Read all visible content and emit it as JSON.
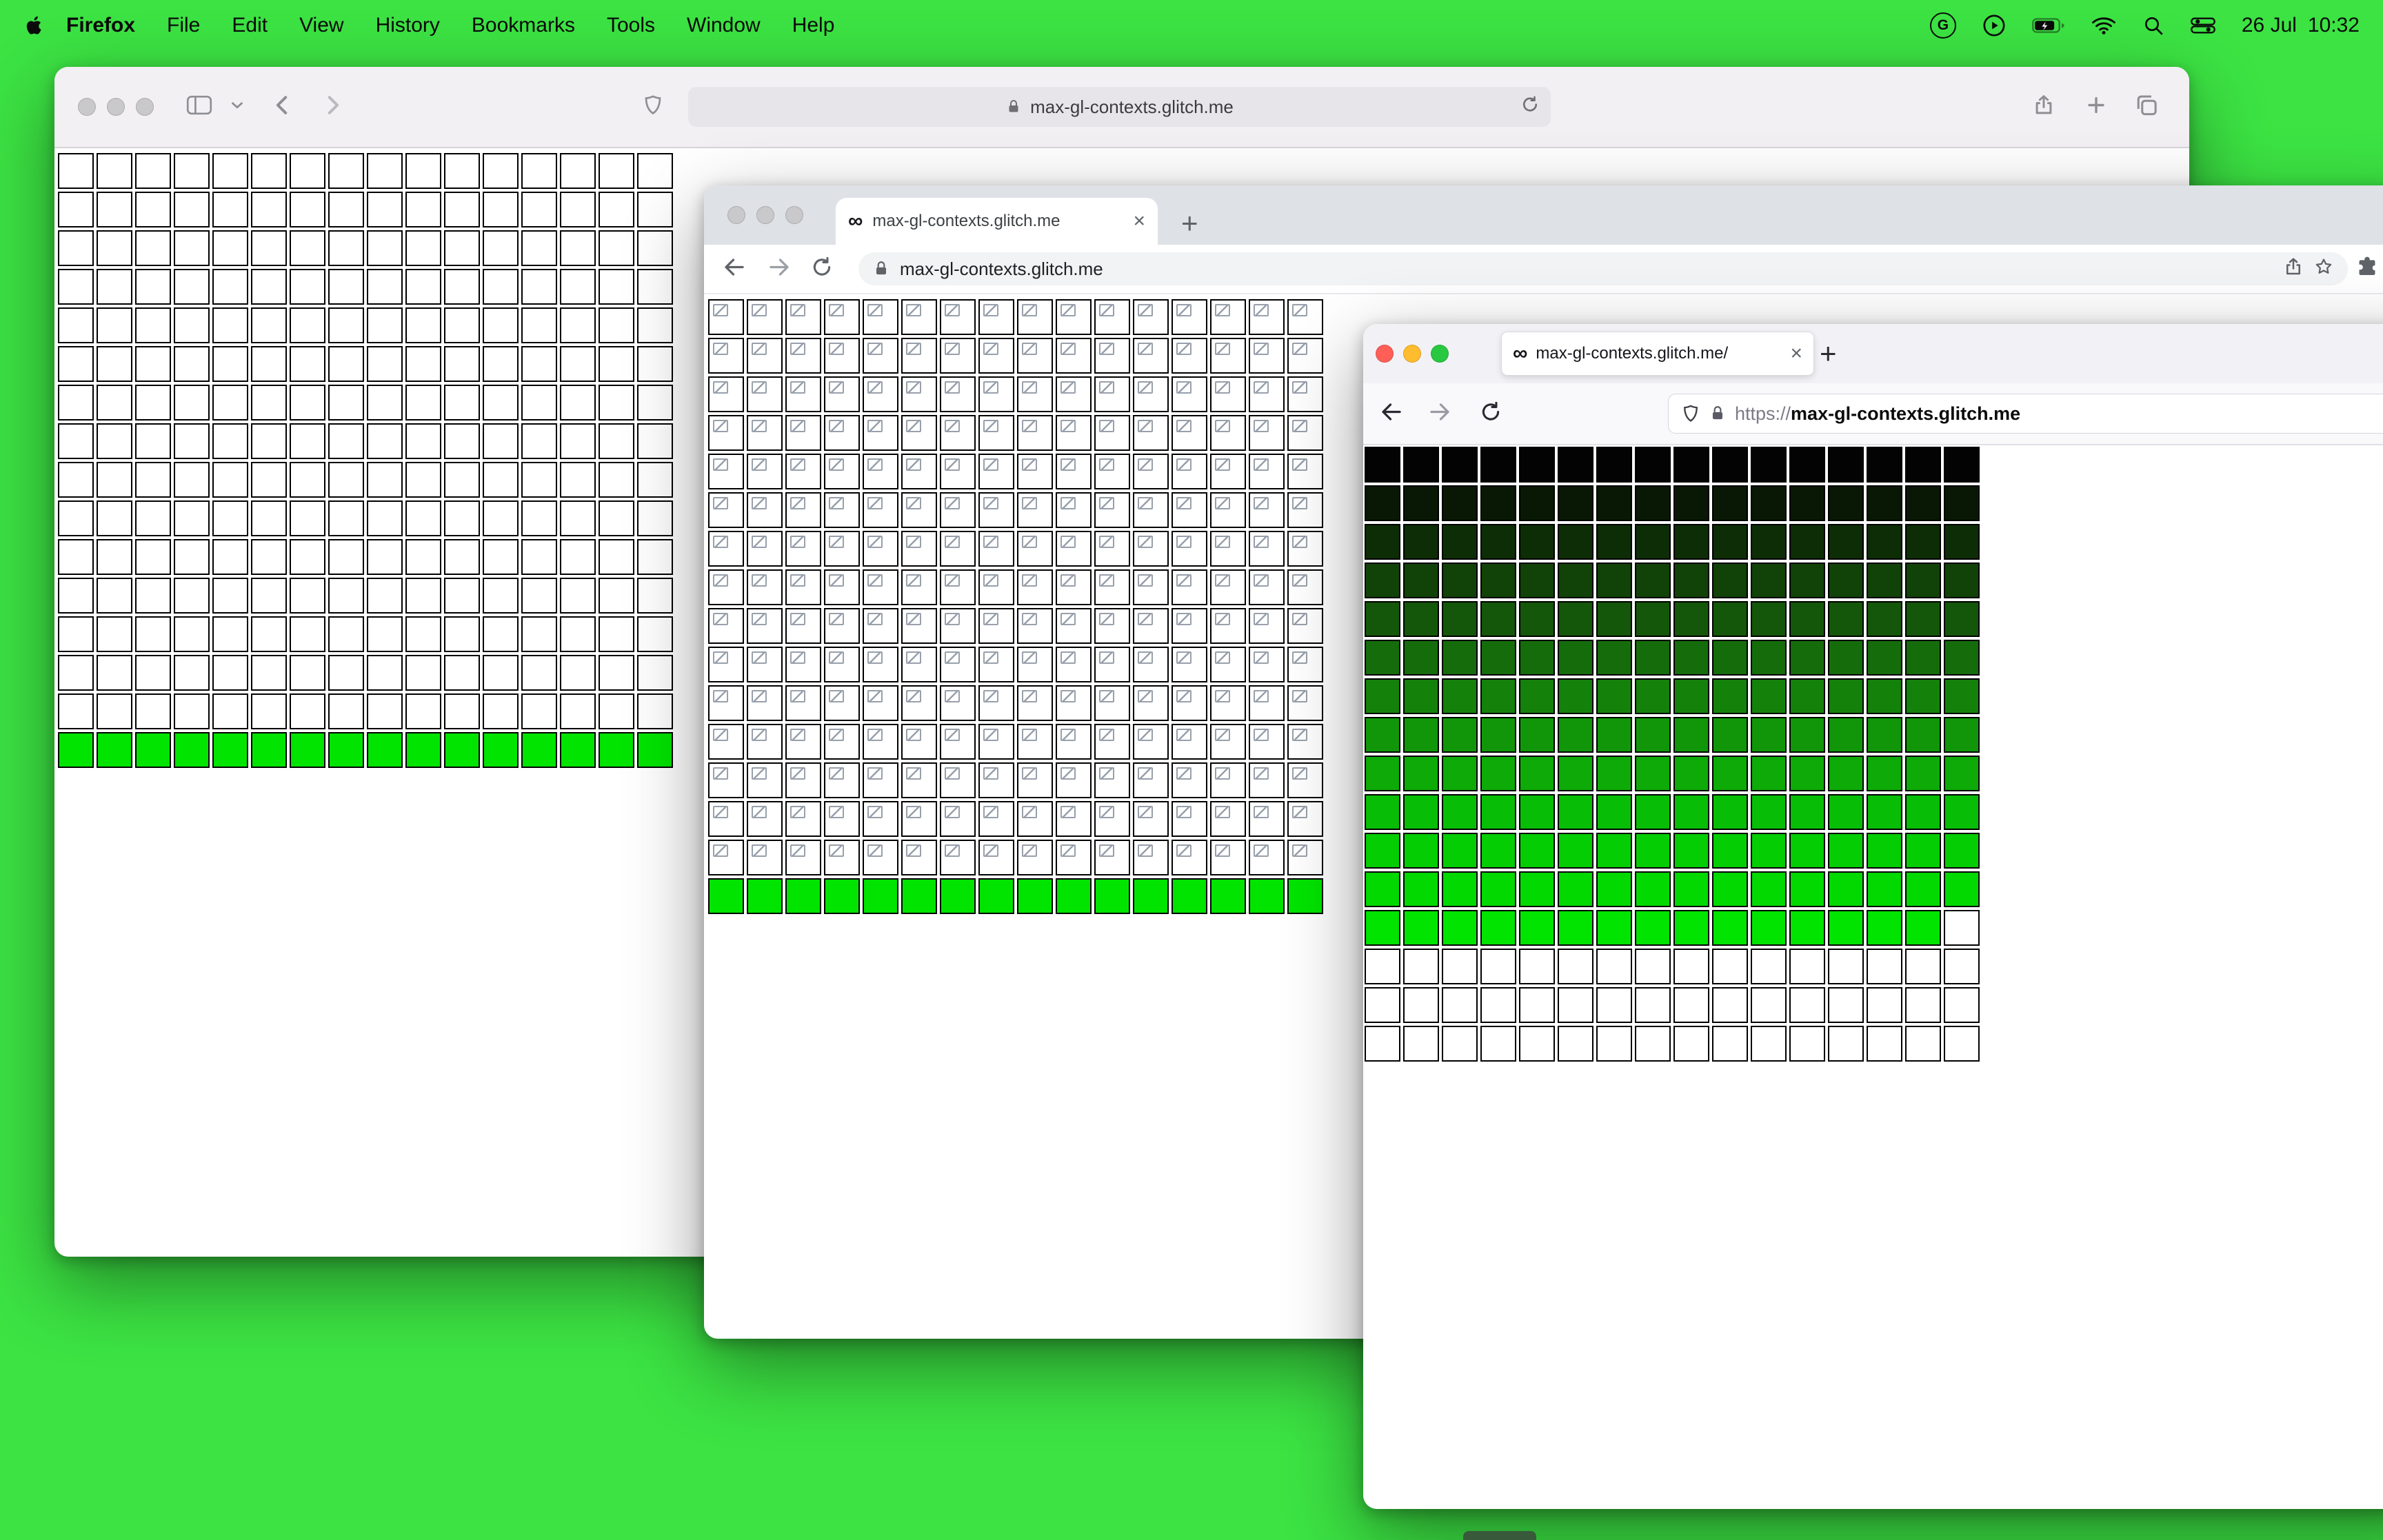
{
  "colors": {
    "desktop": "#3ce343",
    "canvas_green": "#00e400",
    "grid_border": "#000000",
    "traffic": {
      "inactive": "#c9c8cb",
      "red": "#ff5f57",
      "yellow": "#febc2e",
      "green": "#28c840"
    }
  },
  "menubar": {
    "app_name": "Firefox",
    "menus": [
      "File",
      "Edit",
      "View",
      "History",
      "Bookmarks",
      "Tools",
      "Window",
      "Help"
    ],
    "status_icons": [
      "g-badge-icon",
      "play-circle-icon",
      "battery-icon",
      "wifi-icon",
      "spotlight-icon",
      "control-center-icon"
    ],
    "date": "26 Jul",
    "time": "10:32"
  },
  "glyphs": {
    "infinity": "∞",
    "close": "×",
    "new_tab": "+",
    "g_badge": "G"
  },
  "safari": {
    "url": "max-gl-contexts.glitch.me",
    "grid": {
      "cols": 16,
      "cell": 52,
      "gap": 4,
      "border": "#000000",
      "rows": [
        {
          "repeat": 15,
          "color": "#ffffff"
        },
        {
          "repeat": 1,
          "color": "#00e400"
        }
      ]
    }
  },
  "chrome": {
    "tab_title": "max-gl-contexts.glitch.me",
    "url": "max-gl-contexts.glitch.me",
    "grid": {
      "cols": 16,
      "cell": 52,
      "gap": 4,
      "border": "#000000",
      "rows": [
        {
          "repeat": 15,
          "color": "#ffffff",
          "icon": true
        },
        {
          "repeat": 1,
          "color": "#00e400"
        }
      ]
    }
  },
  "firefox": {
    "tab_title": "max-gl-contexts.glitch.me/",
    "url_scheme": "https://",
    "url_domain": "max-gl-contexts.glitch.me",
    "grid": {
      "cols": 16,
      "cell": 52,
      "gap": 4,
      "border": "#000000",
      "rows": [
        {
          "color": "#030303"
        },
        {
          "color": "#081804"
        },
        {
          "color": "#0d2d06"
        },
        {
          "color": "#114208"
        },
        {
          "color": "#14570a"
        },
        {
          "color": "#156c0b"
        },
        {
          "color": "#14810b"
        },
        {
          "color": "#11960a"
        },
        {
          "color": "#0daa08"
        },
        {
          "color": "#08bd06"
        },
        {
          "color": "#04cd03"
        },
        {
          "color": "#01d901"
        },
        {
          "color": "#00e400",
          "tail": 1,
          "tail_color": "#ffffff"
        },
        {
          "repeat": 3,
          "color": "#ffffff"
        }
      ]
    }
  }
}
